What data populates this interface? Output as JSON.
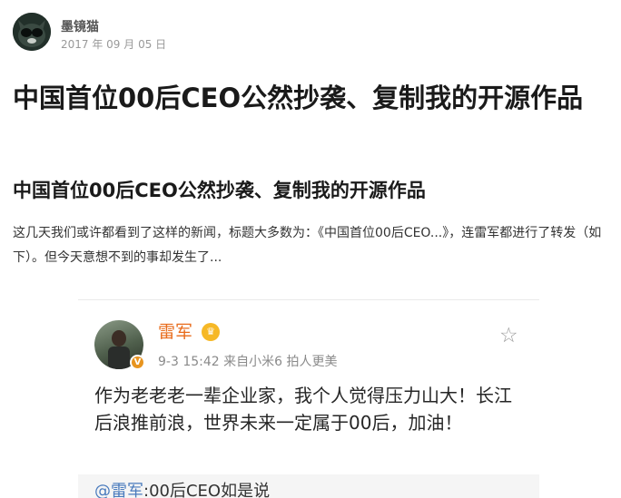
{
  "author": {
    "name": "墨镜猫",
    "date": "2017 年 09 月 05 日"
  },
  "article": {
    "title": "中国首位00后CEO公然抄袭、复制我的开源作品",
    "subtitle": "中国首位00后CEO公然抄袭、复制我的开源作品",
    "intro": "这几天我们或许都看到了这样的新闻，标题大多数为：《中国首位00后CEO...》，连雷军都进行了转发（如下）。但今天意想不到的事却发生了..."
  },
  "weibo": {
    "user": "雷军",
    "meta": "9-3 15:42  来自小米6 拍人更美",
    "text": "作为老老老一辈企业家，我个人觉得压力山大！长江后浪推前浪，世界未来一定属于00后，加油！",
    "repost_user": "@雷军",
    "repost_text": ":00后CEO如是说"
  },
  "icons": {
    "avatar": "cat-sunglasses-avatar",
    "star": "star-icon",
    "crown": "crown-icon",
    "verified": "verified-badge-icon"
  },
  "colors": {
    "weibo_name": "#e86b1b",
    "verified_badge": "#e8951f",
    "link": "#4a7bbd"
  }
}
